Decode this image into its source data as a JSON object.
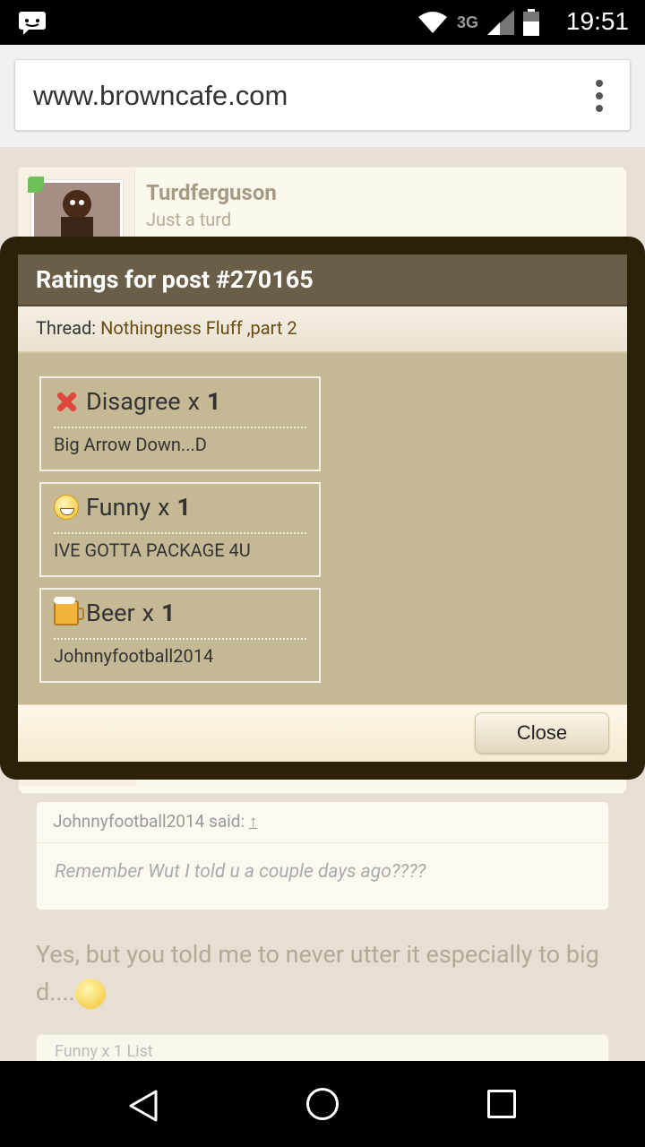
{
  "status_bar": {
    "time": "19:51",
    "network": "3G",
    "notification_icon": "chat-bubble-icon"
  },
  "browser": {
    "url": "www.browncafe.com",
    "menu_icon": "overflow-menu-icon"
  },
  "post": {
    "username": "Turdferguson",
    "user_title": "Just a turd",
    "quote_author": "Johnnyfootball2014 said:",
    "quote_arrow": "↑",
    "quote_text": "Remember Wut I told u a couple days ago????",
    "body_text": "Yes, but you told me to never utter it especially to big d....",
    "ratings_summary": "Funny x 1   List"
  },
  "dialog": {
    "title": "Ratings for post #270165",
    "thread_label": "Thread:",
    "thread_name": "Nothingness Fluff ,part 2",
    "close_label": "Close",
    "ratings": [
      {
        "name": "Disagree",
        "x": "x",
        "count": "1",
        "user": "Big Arrow Down...D",
        "icon": "disagree-x-icon"
      },
      {
        "name": "Funny",
        "x": "x",
        "count": "1",
        "user": "IVE GOTTA PACKAGE 4U",
        "icon": "funny-smiley-icon"
      },
      {
        "name": "Beer",
        "x": "x",
        "count": "1",
        "user": "Johnnyfootball2014",
        "icon": "beer-mug-icon"
      }
    ]
  },
  "colors": {
    "dialog_header": "#6b5e48",
    "dialog_body": "#c5b894",
    "overlay_frame": "#2b2008",
    "thread_link": "#6a4a10"
  }
}
